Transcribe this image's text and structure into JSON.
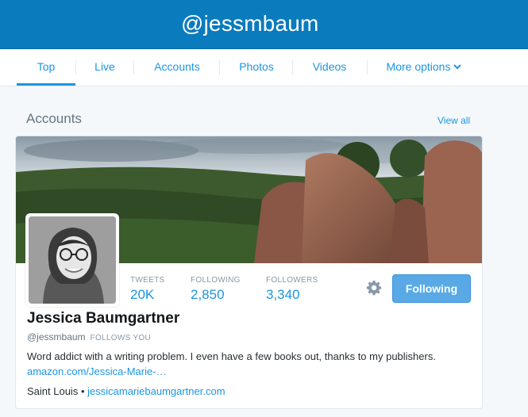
{
  "header": {
    "title": "@jessmbaum"
  },
  "nav": {
    "items": [
      {
        "label": "Top"
      },
      {
        "label": "Live"
      },
      {
        "label": "Accounts"
      },
      {
        "label": "Photos"
      },
      {
        "label": "Videos"
      },
      {
        "label": "More options"
      }
    ],
    "active": "Top",
    "more_icon": "chevron-down-icon"
  },
  "section": {
    "title": "Accounts",
    "view_all": "View all"
  },
  "profile": {
    "name": "Jessica Baumgartner",
    "handle": "@jessmbaum",
    "follows_you": "FOLLOWS YOU",
    "stats": {
      "tweets_label": "TWEETS",
      "tweets": "20K",
      "following_label": "FOLLOWING",
      "following": "2,850",
      "followers_label": "FOLLOWERS",
      "followers": "3,340"
    },
    "follow_button": "Following",
    "settings_icon": "gear-icon",
    "bio_text": "Word addict with a writing problem. I even have a few books out, thanks to my publishers.",
    "bio_link": "amazon.com/Jessica-Marie-…",
    "location": "Saint Louis",
    "separator": "•",
    "website": "jessicamariebaumgartner.com"
  },
  "colors": {
    "header_bg": "#0a7bbd",
    "accent": "#1b95e0",
    "button_bg": "#58a9e6"
  }
}
